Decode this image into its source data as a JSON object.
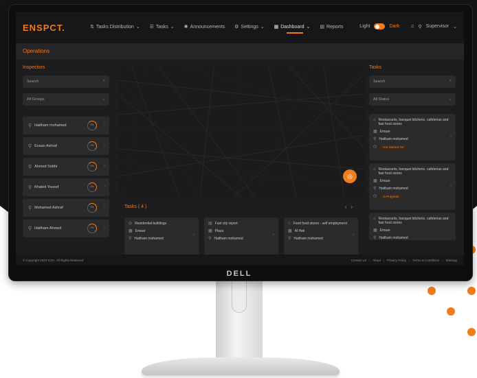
{
  "app": {
    "logo": "ENSPCT.",
    "monitor_brand": "DELL"
  },
  "nav": {
    "items": [
      {
        "label": "Tasks Distribution",
        "icon": "distribution-icon",
        "has_dropdown": true
      },
      {
        "label": "Tasks",
        "icon": "tasks-icon",
        "has_dropdown": true
      },
      {
        "label": "Announcements",
        "icon": "announcement-icon",
        "has_dropdown": false
      },
      {
        "label": "Settings",
        "icon": "settings-icon",
        "has_dropdown": true
      },
      {
        "label": "Dashboard",
        "icon": "dashboard-icon",
        "has_dropdown": true,
        "active": true
      },
      {
        "label": "Reports",
        "icon": "reports-icon",
        "has_dropdown": false
      }
    ],
    "theme_light": "Light",
    "theme_dark": "Dark",
    "user": "Supervisor"
  },
  "page": {
    "title": "Operations"
  },
  "inspectors": {
    "title": "Inspectors",
    "search_placeholder": "Search",
    "group_select": "All Groups",
    "items": [
      {
        "name": "Haitham mohamed",
        "progress": "0%"
      },
      {
        "name": "Ezaan Ashraf",
        "progress": "0%"
      },
      {
        "name": "Ahmed Sobhi",
        "progress": "0%"
      },
      {
        "name": "Khaled Yousef",
        "progress": "0%"
      },
      {
        "name": "Mohamed Ashraf",
        "progress": "0%"
      },
      {
        "name": "Haitham Ahmed",
        "progress": "0%"
      }
    ]
  },
  "tasks_panel": {
    "title": "Tasks",
    "search_placeholder": "Search",
    "status_select": "All Status",
    "cards": [
      {
        "place": "Restaurants, banquet kitchens, cafeterias and fast food stores",
        "category": "Emaar",
        "inspector": "Haitham mohamed",
        "status": "Not Started Yet"
      },
      {
        "place": "Restaurants, banquet kitchens, cafeterias and fast food stores",
        "category": "Emaar",
        "inspector": "Haitham mohamed",
        "status": "In Progress"
      },
      {
        "place": "Restaurants, banquet kitchens, cafeterias and fast food stores",
        "category": "Emaar",
        "inspector": "Haitham mohamed",
        "status": ""
      }
    ]
  },
  "tasks_strip": {
    "title": "Tasks ( 4 )",
    "cards": [
      {
        "place": "Residential buildings",
        "category": "Emaar",
        "inspector": "Haitham mohamed"
      },
      {
        "place": "Fast city report",
        "category": "Plaza",
        "inspector": "Haitham mohamed"
      },
      {
        "place": "Food food stores - self employment",
        "category": "Al Hak",
        "inspector": "Haitham mohamed"
      }
    ]
  },
  "footer": {
    "copyright": "© Copyright 2023 ICZA. All Rights Reserved",
    "links": [
      "Contact Us",
      "About",
      "Privacy Policy",
      "Terms & Conditions",
      "Sitemap"
    ]
  },
  "colors": {
    "accent": "#f07c1c",
    "screen_bg": "#1d1d20",
    "card_bg": "#2b2b2e"
  }
}
